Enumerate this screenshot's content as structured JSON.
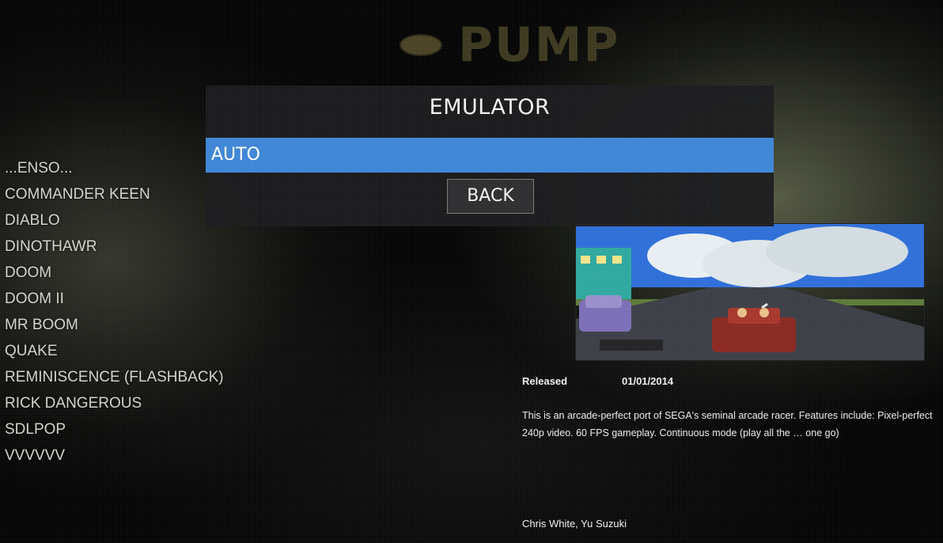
{
  "header": {
    "logo_text": "PUMP"
  },
  "game_list": [
    "...ENSO...",
    "COMMANDER KEEN",
    "DIABLO",
    "DINOTHAWR",
    "DOOM",
    "DOOM II",
    "MR BOOM",
    "QUAKE",
    "REMINISCENCE (FLASHBACK)",
    "RICK DANGEROUS",
    "SDLPOP",
    "VVVVVV"
  ],
  "emulator_dialog": {
    "title": "EMULATOR",
    "selected_option": "AUTO",
    "back_label": "BACK"
  },
  "game_details": {
    "released_label": "Released",
    "released_date": "01/01/2014",
    "description": "This is an arcade-perfect port of SEGA's seminal arcade racer. Features include: Pixel-perfect 240p video. 60 FPS gameplay. Continuous mode (play all the … one go)",
    "developer": "Chris White, Yu Suzuki"
  },
  "colors": {
    "selection_blue": "#3f86d6",
    "dialog_bg": "#1c1c1e"
  }
}
